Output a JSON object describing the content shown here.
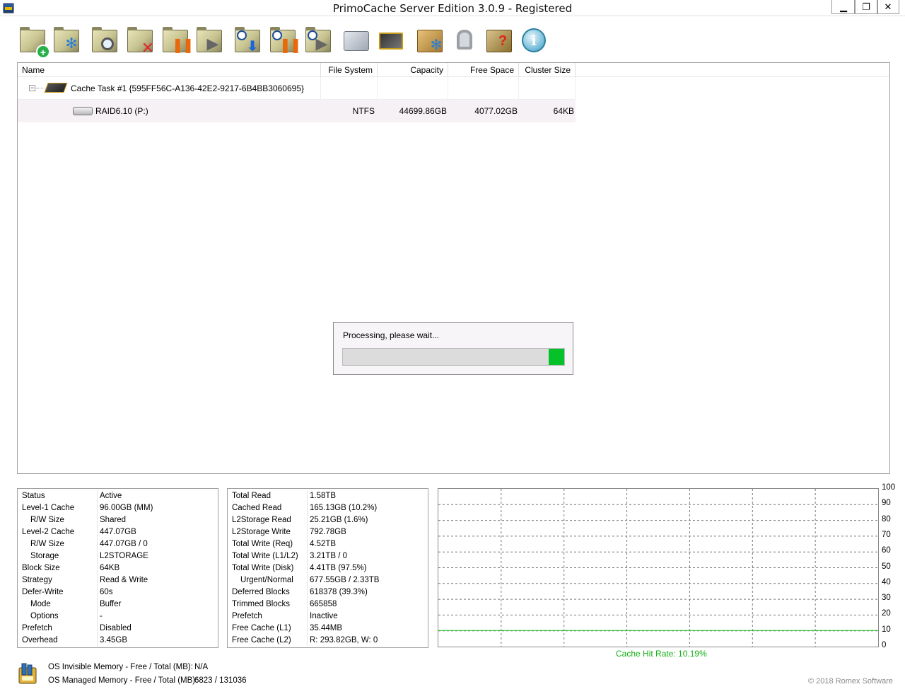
{
  "window": {
    "title": "PrimoCache Server Edition 3.0.9 - Registered",
    "min_glyph": "▁",
    "restore_glyph": "❐",
    "close_glyph": "✕"
  },
  "toolbar": {
    "items": [
      {
        "icon": "add-task-icon"
      },
      {
        "icon": "task-settings-icon"
      },
      {
        "icon": "task-details-icon"
      },
      {
        "icon": "delete-task-icon"
      },
      {
        "icon": "pause-task-icon"
      },
      {
        "icon": "resume-task-icon"
      },
      {
        "icon": "prefetch-icon"
      },
      {
        "icon": "pause-prefetch-icon"
      },
      {
        "icon": "resume-prefetch-icon"
      },
      {
        "icon": "tools-icon"
      },
      {
        "icon": "memory-chip-icon"
      },
      {
        "icon": "options-icon"
      },
      {
        "icon": "license-key-icon"
      },
      {
        "icon": "help-icon"
      },
      {
        "icon": "info-icon"
      }
    ]
  },
  "tree": {
    "columns": [
      "Name",
      "File System",
      "Capacity",
      "Free Space",
      "Cluster Size"
    ],
    "task": {
      "expander": "−",
      "name": "Cache Task #1 {595FF56C-A136-42E2-9217-6B4BB3060695}"
    },
    "volume": {
      "name": "RAID6.10 (P:)",
      "fs": "NTFS",
      "capacity": "44699.86GB",
      "free": "4077.02GB",
      "cluster": "64KB"
    }
  },
  "progress": {
    "message": "Processing, please wait...",
    "fraction": 0.07
  },
  "stats_left": [
    {
      "k": "Status",
      "v": "Active",
      "indent": false
    },
    {
      "k": "Level-1 Cache",
      "v": "96.00GB (MM)",
      "indent": false
    },
    {
      "k": "R/W Size",
      "v": "Shared",
      "indent": true
    },
    {
      "k": "Level-2 Cache",
      "v": "447.07GB",
      "indent": false
    },
    {
      "k": "R/W Size",
      "v": "447.07GB / 0",
      "indent": true
    },
    {
      "k": "Storage",
      "v": "L2STORAGE",
      "indent": true
    },
    {
      "k": "Block Size",
      "v": "64KB",
      "indent": false
    },
    {
      "k": "Strategy",
      "v": "Read & Write",
      "indent": false
    },
    {
      "k": "Defer-Write",
      "v": "60s",
      "indent": false
    },
    {
      "k": "Mode",
      "v": "Buffer",
      "indent": true
    },
    {
      "k": "Options",
      "v": "-",
      "indent": true
    },
    {
      "k": "Prefetch",
      "v": "Disabled",
      "indent": false
    },
    {
      "k": "Overhead",
      "v": "3.45GB",
      "indent": false
    }
  ],
  "stats_mid": [
    {
      "k": "Total Read",
      "v": "1.58TB",
      "indent": false
    },
    {
      "k": "Cached Read",
      "v": "165.13GB (10.2%)",
      "indent": false
    },
    {
      "k": "L2Storage Read",
      "v": "25.21GB (1.6%)",
      "indent": false
    },
    {
      "k": "L2Storage Write",
      "v": "792.78GB",
      "indent": false
    },
    {
      "k": "Total Write (Req)",
      "v": "4.52TB",
      "indent": false
    },
    {
      "k": "Total Write (L1/L2)",
      "v": "3.21TB / 0",
      "indent": false
    },
    {
      "k": "Total Write (Disk)",
      "v": "4.41TB (97.5%)",
      "indent": false
    },
    {
      "k": "Urgent/Normal",
      "v": "677.55GB / 2.33TB",
      "indent": true
    },
    {
      "k": "Deferred Blocks",
      "v": "618378 (39.3%)",
      "indent": false
    },
    {
      "k": "Trimmed Blocks",
      "v": "665858",
      "indent": false
    },
    {
      "k": "Prefetch",
      "v": "Inactive",
      "indent": false
    },
    {
      "k": "Free Cache (L1)",
      "v": "35.44MB",
      "indent": false
    },
    {
      "k": "Free Cache (L2)",
      "v": "R: 293.82GB, W: 0",
      "indent": false
    }
  ],
  "chart_data": {
    "type": "line",
    "ylim": [
      0,
      100
    ],
    "y_ticks": [
      "100",
      "90",
      "80",
      "70",
      "60",
      "50",
      "40",
      "30",
      "20",
      "10",
      "0"
    ],
    "grid": true,
    "vertical_divisions": 7,
    "series": [
      {
        "name": "Cache Hit Rate",
        "values": [
          10.19,
          10.19
        ]
      }
    ],
    "caption": "Cache Hit Rate: 10.19%",
    "line_color": "#1fbf1f"
  },
  "memory": {
    "invisible_label": "OS Invisible Memory - Free / Total (MB):",
    "invisible_value": "N/A",
    "managed_label": "OS Managed Memory - Free / Total (MB):",
    "managed_value": "6823 / 131036"
  },
  "footer": {
    "copyright": "© 2018 Romex Software"
  },
  "colors": {
    "progress_fill": "#06c22a",
    "chart_line": "#1fbf1f"
  }
}
